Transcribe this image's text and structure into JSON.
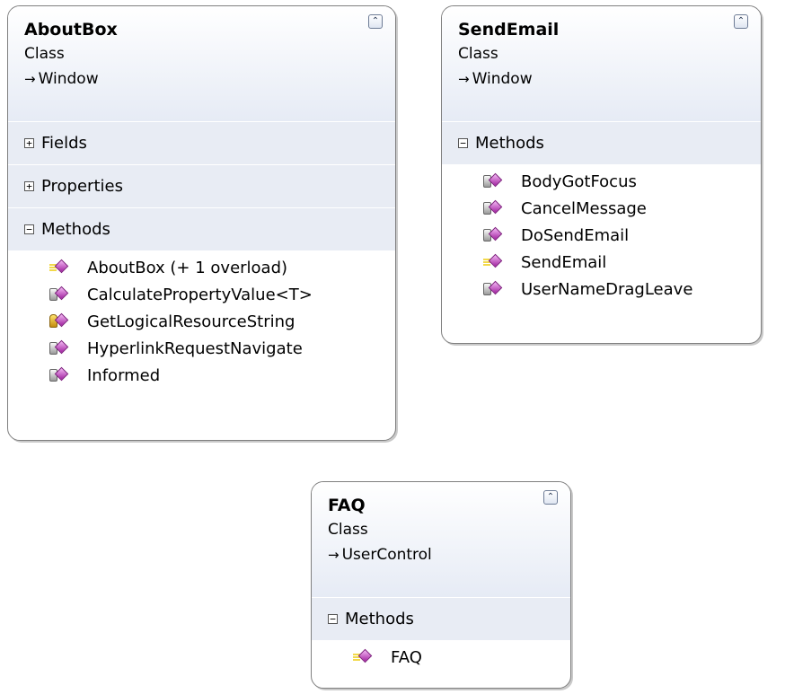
{
  "collapse_glyph": "⌃",
  "icons": {
    "public": "public-method-icon",
    "private": "private-method-icon",
    "protected": "protected-method-icon"
  },
  "classes": [
    {
      "title": "AboutBox",
      "stereotype": "Class",
      "base": "Window",
      "sections": [
        {
          "label": "Fields",
          "toggle": "+"
        },
        {
          "label": "Properties",
          "toggle": "+"
        },
        {
          "label": "Methods",
          "toggle": "−"
        }
      ],
      "methods": [
        {
          "name": "AboutBox (+ 1 overload)",
          "access": "public"
        },
        {
          "name": "CalculatePropertyValue<T>",
          "access": "private"
        },
        {
          "name": "GetLogicalResourceString",
          "access": "protected"
        },
        {
          "name": "HyperlinkRequestNavigate",
          "access": "private"
        },
        {
          "name": "Informed",
          "access": "private"
        }
      ]
    },
    {
      "title": "SendEmail",
      "stereotype": "Class",
      "base": "Window",
      "sections": [
        {
          "label": "Methods",
          "toggle": "−"
        }
      ],
      "methods": [
        {
          "name": "BodyGotFocus",
          "access": "private"
        },
        {
          "name": "CancelMessage",
          "access": "private"
        },
        {
          "name": "DoSendEmail",
          "access": "private"
        },
        {
          "name": "SendEmail",
          "access": "public"
        },
        {
          "name": "UserNameDragLeave",
          "access": "private"
        }
      ]
    },
    {
      "title": "FAQ",
      "stereotype": "Class",
      "base": "UserControl",
      "sections": [
        {
          "label": "Methods",
          "toggle": "−"
        }
      ],
      "methods": [
        {
          "name": "FAQ",
          "access": "public"
        }
      ]
    }
  ]
}
